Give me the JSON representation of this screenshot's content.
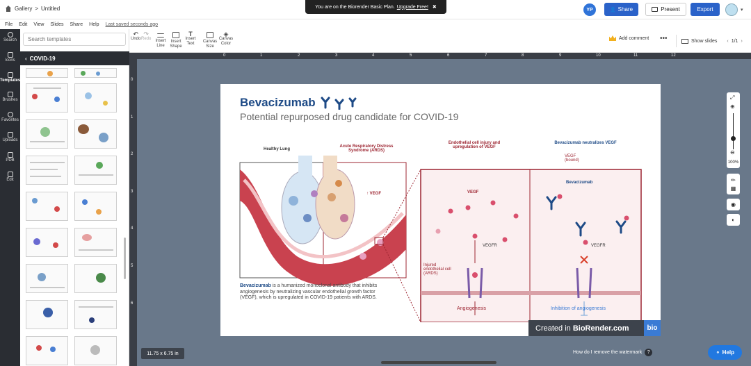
{
  "header": {
    "crumb_gallery": "Gallery",
    "crumb_sep": ">",
    "doc_title": "Untitled",
    "banner_text": "You are on the Biorender Basic Plan.",
    "banner_link": "Upgrade Free!",
    "banner_close": "✖",
    "avatar_initials": "YP",
    "share_label": "Share",
    "present_label": "Present",
    "export_label": "Export"
  },
  "menu": {
    "file": "File",
    "edit": "Edit",
    "view": "View",
    "slides": "Slides",
    "share": "Share",
    "help": "Help",
    "last_saved": "Last saved seconds ago"
  },
  "rail": {
    "search": "Search",
    "icons": "Icons",
    "templates": "Templates",
    "brushes": "Brushes",
    "favorites": "Favorites",
    "uploads": "Uploads",
    "pdb": "PDB",
    "edit": "Edit"
  },
  "panel": {
    "search_placeholder": "Search templates",
    "category": "COVID-19"
  },
  "toolbar": {
    "undo": "Undo",
    "redo": "Redo",
    "insert_line": "Insert Line",
    "insert_shape": "Insert Shape",
    "insert_text": "Insert Text",
    "canvas_size": "Canvas Size",
    "canvas_color": "Canvas Color",
    "add_comment": "Add comment",
    "more": "•••",
    "show_slides": "Show slides",
    "slide_counter": "1/1"
  },
  "ruler": {
    "top": [
      "0",
      "1",
      "2",
      "3",
      "4",
      "5",
      "6",
      "7",
      "8",
      "9",
      "10",
      "11",
      "12"
    ],
    "left": [
      "0",
      "1",
      "2",
      "3",
      "4",
      "5",
      "6"
    ]
  },
  "zoom": {
    "level": "100%"
  },
  "slide": {
    "title": "Bevacizumab",
    "subtitle": "Potential repurposed drug candidate for COVID-19",
    "healthy_lung": "Healthy Lung",
    "ards_line1": "Acute Respiratory Distress",
    "ards_line2": "Syndrome (ARDS)",
    "vegf_arrow": "↑ VEGF",
    "panel1_title_line1": "Endothelial cell injury and",
    "panel1_title_line2": "upregulation of VEGF",
    "panel2_title": "Bevacizumab neutralizes VEGF",
    "vegf": "VEGF",
    "vegf_bound_line1": "VEGF",
    "vegf_bound_line2": "(bound)",
    "bevacizumab_label": "Bevacizumab",
    "vegfr_left": "VEGFR",
    "vegfr_right": "VEGFR",
    "injured_line1": "Injured",
    "injured_line2": "endothelial cell",
    "injured_line3": "(ARDS)",
    "angiogenesis": "Angiogenesis",
    "inhibition": "Inhibition of angiogenesis",
    "desc_bold": "Bevacizumab",
    "desc_rest": " is a humanized monoclonal antibody that inhibits angiogenesis by neutralizing vascular endothelial growth factor (VEGF), which is upregulated in COVID-19 patients with ARDS.",
    "watermark_prefix": "Created in ",
    "watermark_brand": "BioRender.com",
    "watermark_logo": "bio"
  },
  "footer": {
    "canvas_dims": "11.75 x 6.75 in",
    "watermark_question": "How do I remove the watermark",
    "help": "Help"
  },
  "colors": {
    "brand_blue": "#2a62c9",
    "title_navy": "#1d4a86",
    "accent_red": "#9c2430",
    "stage_gray": "#69788a",
    "rail_dark": "#2a2d33"
  }
}
